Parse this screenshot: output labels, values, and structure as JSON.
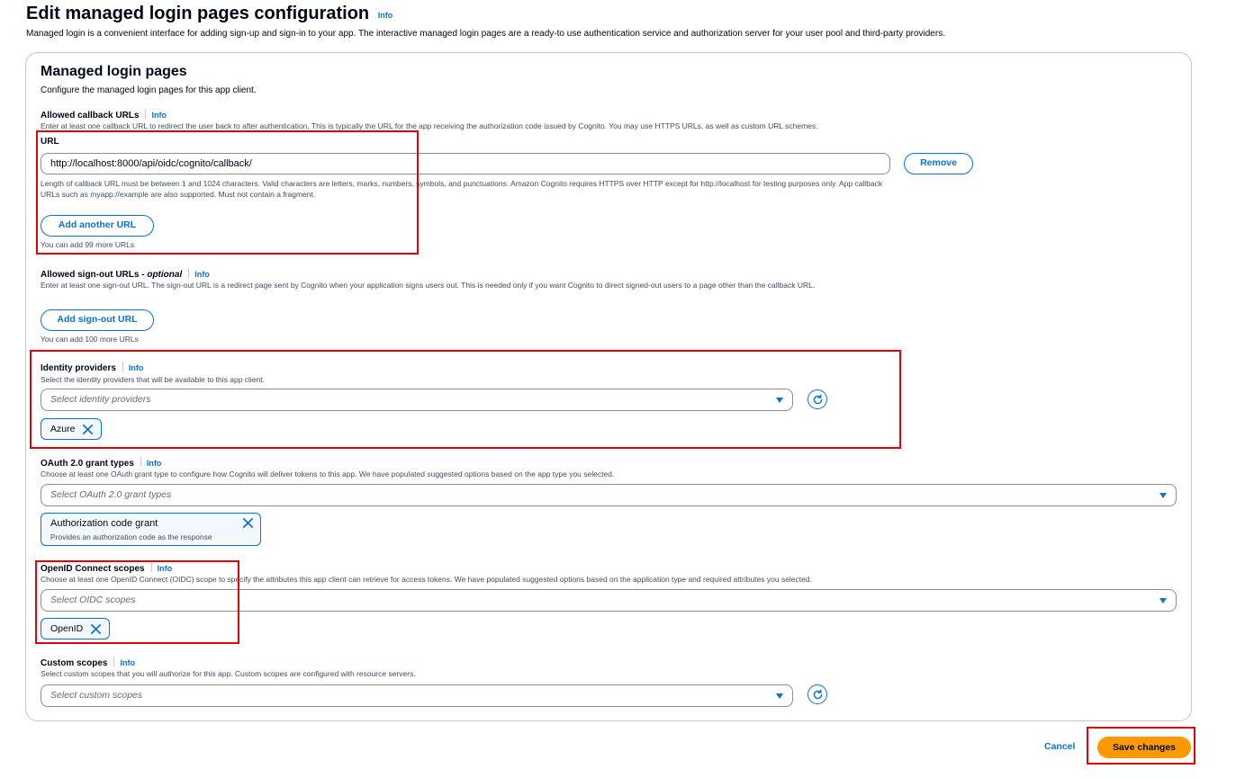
{
  "page": {
    "title": "Edit managed login pages configuration",
    "info": "Info",
    "description": "Managed login is a convenient interface for adding sign-up and sign-in to your app. The interactive managed login pages are a ready-to use authentication service and authorization server for your user pool and third-party providers."
  },
  "card": {
    "title": "Managed login pages",
    "subtitle": "Configure the managed login pages for this app client."
  },
  "callback": {
    "label": "Allowed callback URLs",
    "info": "Info",
    "description": "Enter at least one callback URL to redirect the user back to after authentication. This is typically the URL for the app receiving the authorization code issued by Cognito. You may use HTTPS URLs, as well as custom URL schemes.",
    "url_label": "URL",
    "url_value": "http://localhost:8000/api/oidc/cognito/callback/",
    "remove_label": "Remove",
    "constraint": "Length of callback URL must be between 1 and 1024 characters. Valid characters are letters, marks, numbers, symbols, and punctuations. Amazon Cognito requires HTTPS over HTTP except for http://localhost for testing purposes only. App callback URLs such as myapp://example are also supported. Must not contain a fragment.",
    "add_label": "Add another URL",
    "remaining": "You can add 99 more URLs"
  },
  "signout": {
    "label": "Allowed sign-out URLs",
    "optional": "optional",
    "info": "Info",
    "description": "Enter at least one sign-out URL. The sign-out URL is a redirect page sent by Cognito when your application signs users out. This is needed only if you want Cognito to direct signed-out users to a page other than the callback URL.",
    "add_label": "Add sign-out URL",
    "remaining": "You can add 100 more URLs"
  },
  "identity_providers": {
    "label": "Identity providers",
    "info": "Info",
    "description": "Select the identity providers that will be available to this app client.",
    "placeholder": "Select identity providers",
    "tokens": [
      "Azure"
    ]
  },
  "grant_types": {
    "label": "OAuth 2.0 grant types",
    "info": "Info",
    "description": "Choose at least one OAuth grant type to configure how Cognito will deliver tokens to this app. We have populated suggested options based on the app type you selected.",
    "placeholder": "Select OAuth 2.0 grant types",
    "token_title": "Authorization code grant",
    "token_desc": "Provides an authorization code as the response"
  },
  "oidc_scopes": {
    "label": "OpenID Connect scopes",
    "info": "Info",
    "description": "Choose at least one OpenID Connect (OIDC) scope to specify the attributes this app client can retrieve for access tokens. We have populated suggested options based on the application type and required attributes you selected.",
    "placeholder": "Select OIDC scopes",
    "tokens": [
      "OpenID"
    ]
  },
  "custom_scopes": {
    "label": "Custom scopes",
    "info": "Info",
    "description": "Select custom scopes that you will authorize for this app. Custom scopes are configured with resource servers.",
    "placeholder": "Select custom scopes"
  },
  "footer": {
    "cancel_label": "Cancel",
    "save_label": "Save changes"
  },
  "colors": {
    "accent": "#0972d3",
    "primary_button": "#ff9900",
    "highlight": "#e8000b"
  }
}
